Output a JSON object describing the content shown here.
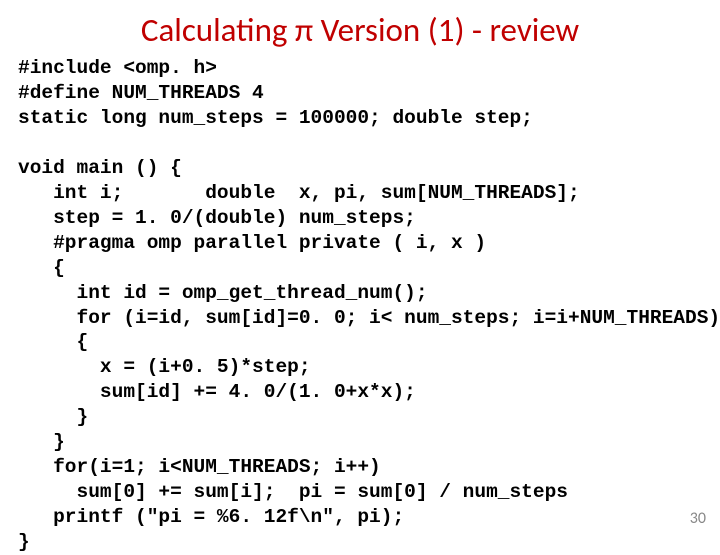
{
  "title": "Calculating π Version (1) - review",
  "code": {
    "l1": "#include <omp. h>",
    "l2": "#define NUM_THREADS 4",
    "l3": "static long num_steps = 100000; double step;",
    "l4": "",
    "l5": "void main () {",
    "l6": "   int i;       double  x, pi, sum[NUM_THREADS];",
    "l7": "   step = 1. 0/(double) num_steps;",
    "l8": "   #pragma omp parallel private ( i, x )",
    "l9": "   {",
    "l10": "     int id = omp_get_thread_num();",
    "l11": "     for (i=id, sum[id]=0. 0; i< num_steps; i=i+NUM_THREADS)",
    "l12": "     {",
    "l13": "       x = (i+0. 5)*step;",
    "l14": "       sum[id] += 4. 0/(1. 0+x*x);",
    "l15": "     }",
    "l16": "   }",
    "l17": "   for(i=1; i<NUM_THREADS; i++)",
    "l18": "     sum[0] += sum[i];  pi = sum[0] / num_steps",
    "l19": "   printf (\"pi = %6. 12f\\n\", pi);",
    "l20": "}"
  },
  "page_number": "30"
}
